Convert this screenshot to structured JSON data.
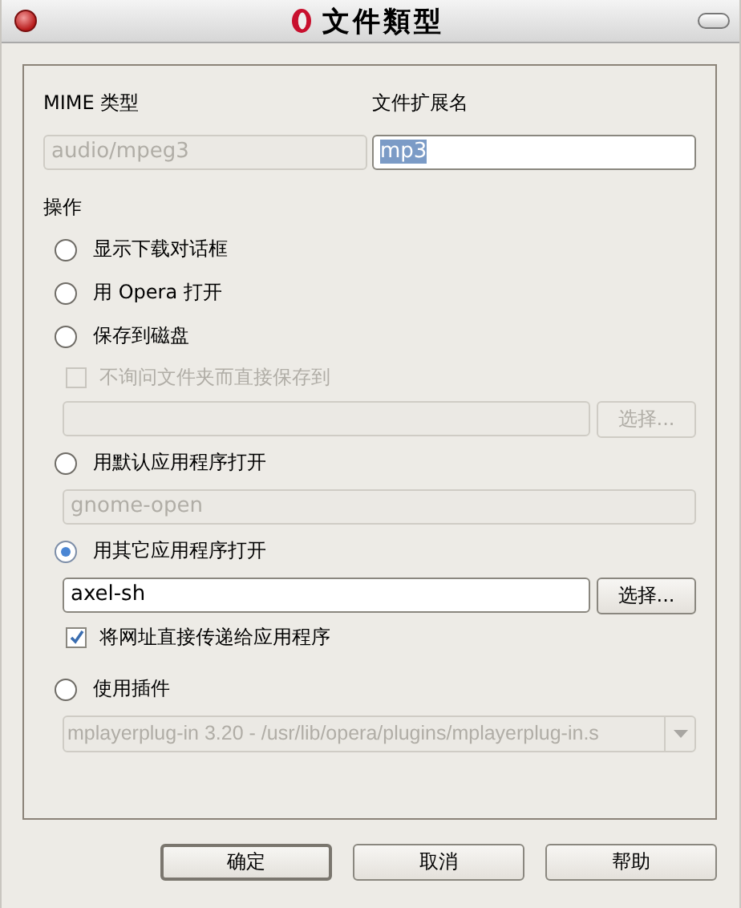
{
  "window": {
    "title": "文件類型"
  },
  "mime": {
    "label": "MIME 类型",
    "value": "audio/mpeg3",
    "disabled": true
  },
  "extension": {
    "label": "文件扩展名",
    "value": "mp3",
    "text_selected": true
  },
  "section_label": "操作",
  "actions": [
    {
      "kind": "radio",
      "label": "显示下载对话框",
      "selected": false
    },
    {
      "kind": "radio",
      "label": "用 Opera 打开",
      "selected": false
    },
    {
      "kind": "radio",
      "label": "保存到磁盘",
      "selected": false
    },
    {
      "kind": "checkbox",
      "label": "不询问文件夹而直接保存到",
      "checked": false,
      "disabled": true
    },
    {
      "kind": "path",
      "button": "选择...",
      "disabled": true
    },
    {
      "kind": "radio",
      "label": "用默认应用程序打开",
      "selected": false
    },
    {
      "kind": "field",
      "value": "gnome-open",
      "disabled": true
    },
    {
      "kind": "radio",
      "label": "用其它应用程序打开",
      "selected": true
    },
    {
      "kind": "path",
      "value": "axel-sh",
      "button": "选择...",
      "disabled": false
    },
    {
      "kind": "checkbox",
      "label": "将网址直接传递给应用程序",
      "checked": true,
      "disabled": false
    },
    {
      "kind": "radio",
      "label": "使用插件",
      "selected": false
    },
    {
      "kind": "dropdown",
      "value": "mplayerplug-in 3.20 - /usr/lib/opera/plugins/mplayerplug-in.s",
      "disabled": true
    }
  ],
  "buttons": [
    {
      "label": "确定",
      "default": true
    },
    {
      "label": "取消",
      "default": false
    },
    {
      "label": "帮助",
      "default": false
    }
  ]
}
